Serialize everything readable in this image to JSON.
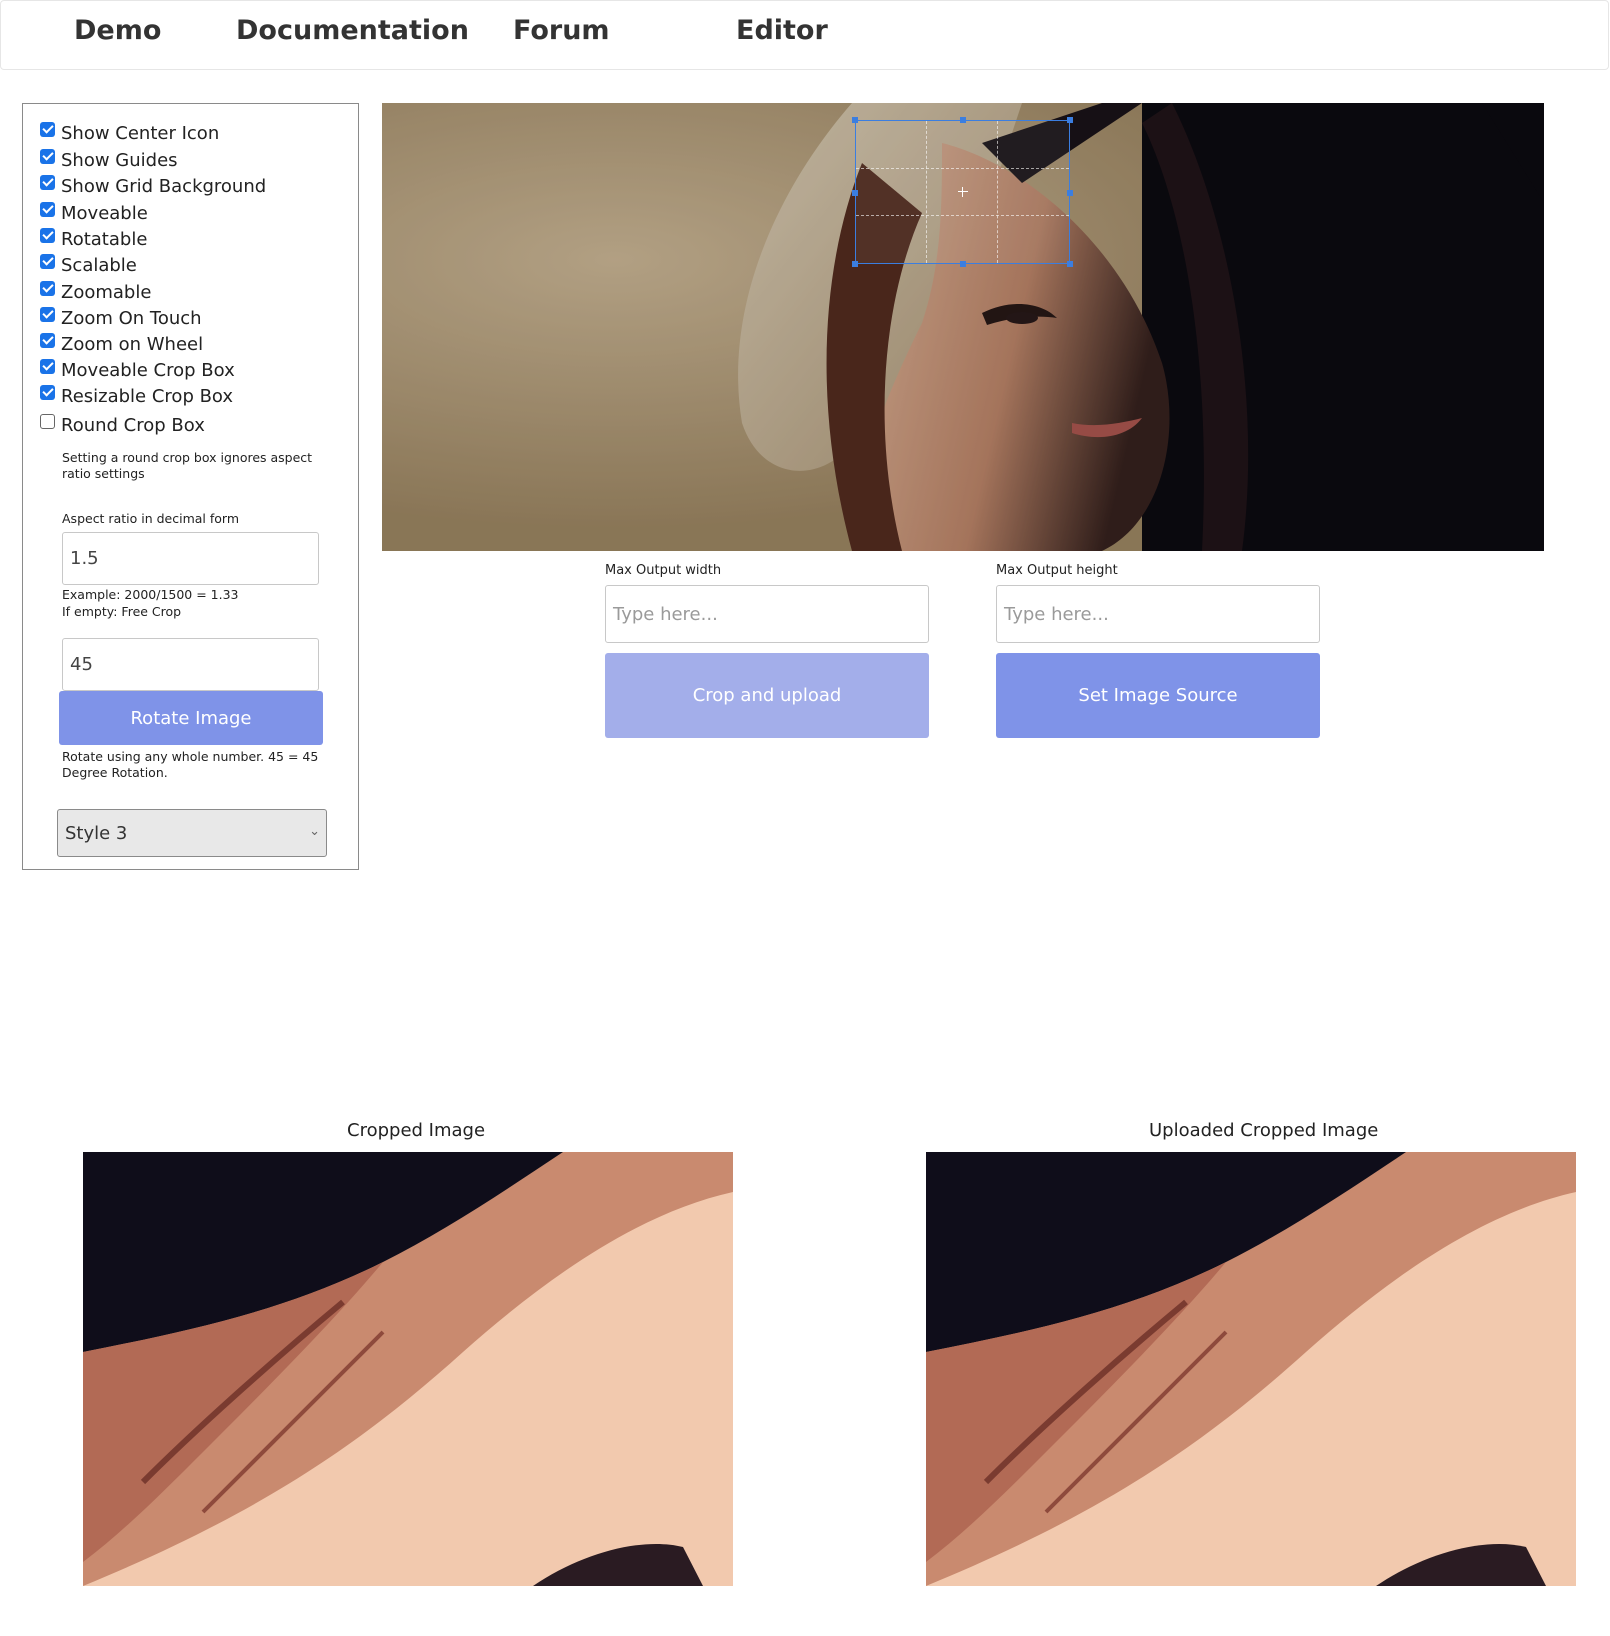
{
  "nav": {
    "demo": "Demo",
    "documentation": "Documentation",
    "forum": "Forum",
    "editor": "Editor"
  },
  "options": {
    "checkboxes": [
      {
        "label": "Show Center Icon",
        "checked": true
      },
      {
        "label": "Show Guides",
        "checked": true
      },
      {
        "label": "Show Grid Background",
        "checked": true
      },
      {
        "label": "Moveable",
        "checked": true
      },
      {
        "label": "Rotatable",
        "checked": true
      },
      {
        "label": "Scalable",
        "checked": true
      },
      {
        "label": "Zoomable",
        "checked": true
      },
      {
        "label": "Zoom On Touch",
        "checked": true
      },
      {
        "label": "Zoom on Wheel",
        "checked": true
      },
      {
        "label": "Moveable Crop Box",
        "checked": true
      },
      {
        "label": "Resizable Crop Box",
        "checked": true
      },
      {
        "label": "Round Crop Box",
        "checked": false
      }
    ],
    "round_note": "Setting a round crop box ignores aspect ratio settings",
    "aspect_label": "Aspect ratio in decimal form",
    "aspect_value": "1.5",
    "aspect_help_1": "Example: 2000/1500 = 1.33",
    "aspect_help_2": "If empty: Free Crop",
    "rotate_value": "45",
    "rotate_button": "Rotate Image",
    "rotate_help": "Rotate using any whole number. 45 = 45 Degree Rotation.",
    "style_select": "Style 3"
  },
  "output": {
    "width_label": "Max Output width",
    "width_placeholder": "Type here...",
    "height_label": "Max Output height",
    "height_placeholder": "Type here...",
    "crop_button": "Crop and upload",
    "source_button": "Set Image Source"
  },
  "results": {
    "cropped_title": "Cropped Image",
    "uploaded_title": "Uploaded Cropped Image"
  },
  "colors": {
    "accent": "#1a73e8",
    "button": "#7f93e8",
    "button_disabled": "#a3aeea",
    "crop_outline": "#3b7ee0"
  }
}
